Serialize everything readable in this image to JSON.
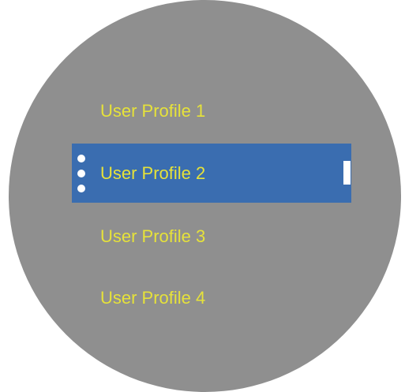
{
  "theme": {
    "face_color": "#8f8f8f",
    "selected_color": "#3a6db0",
    "text_color": "#e6e23a",
    "indicator_color": "#ffffff"
  },
  "menu": {
    "selected_index": 1,
    "items": [
      {
        "label": "User Profile 1"
      },
      {
        "label": "User Profile 2"
      },
      {
        "label": "User Profile 3"
      },
      {
        "label": "User Profile 4"
      }
    ]
  }
}
